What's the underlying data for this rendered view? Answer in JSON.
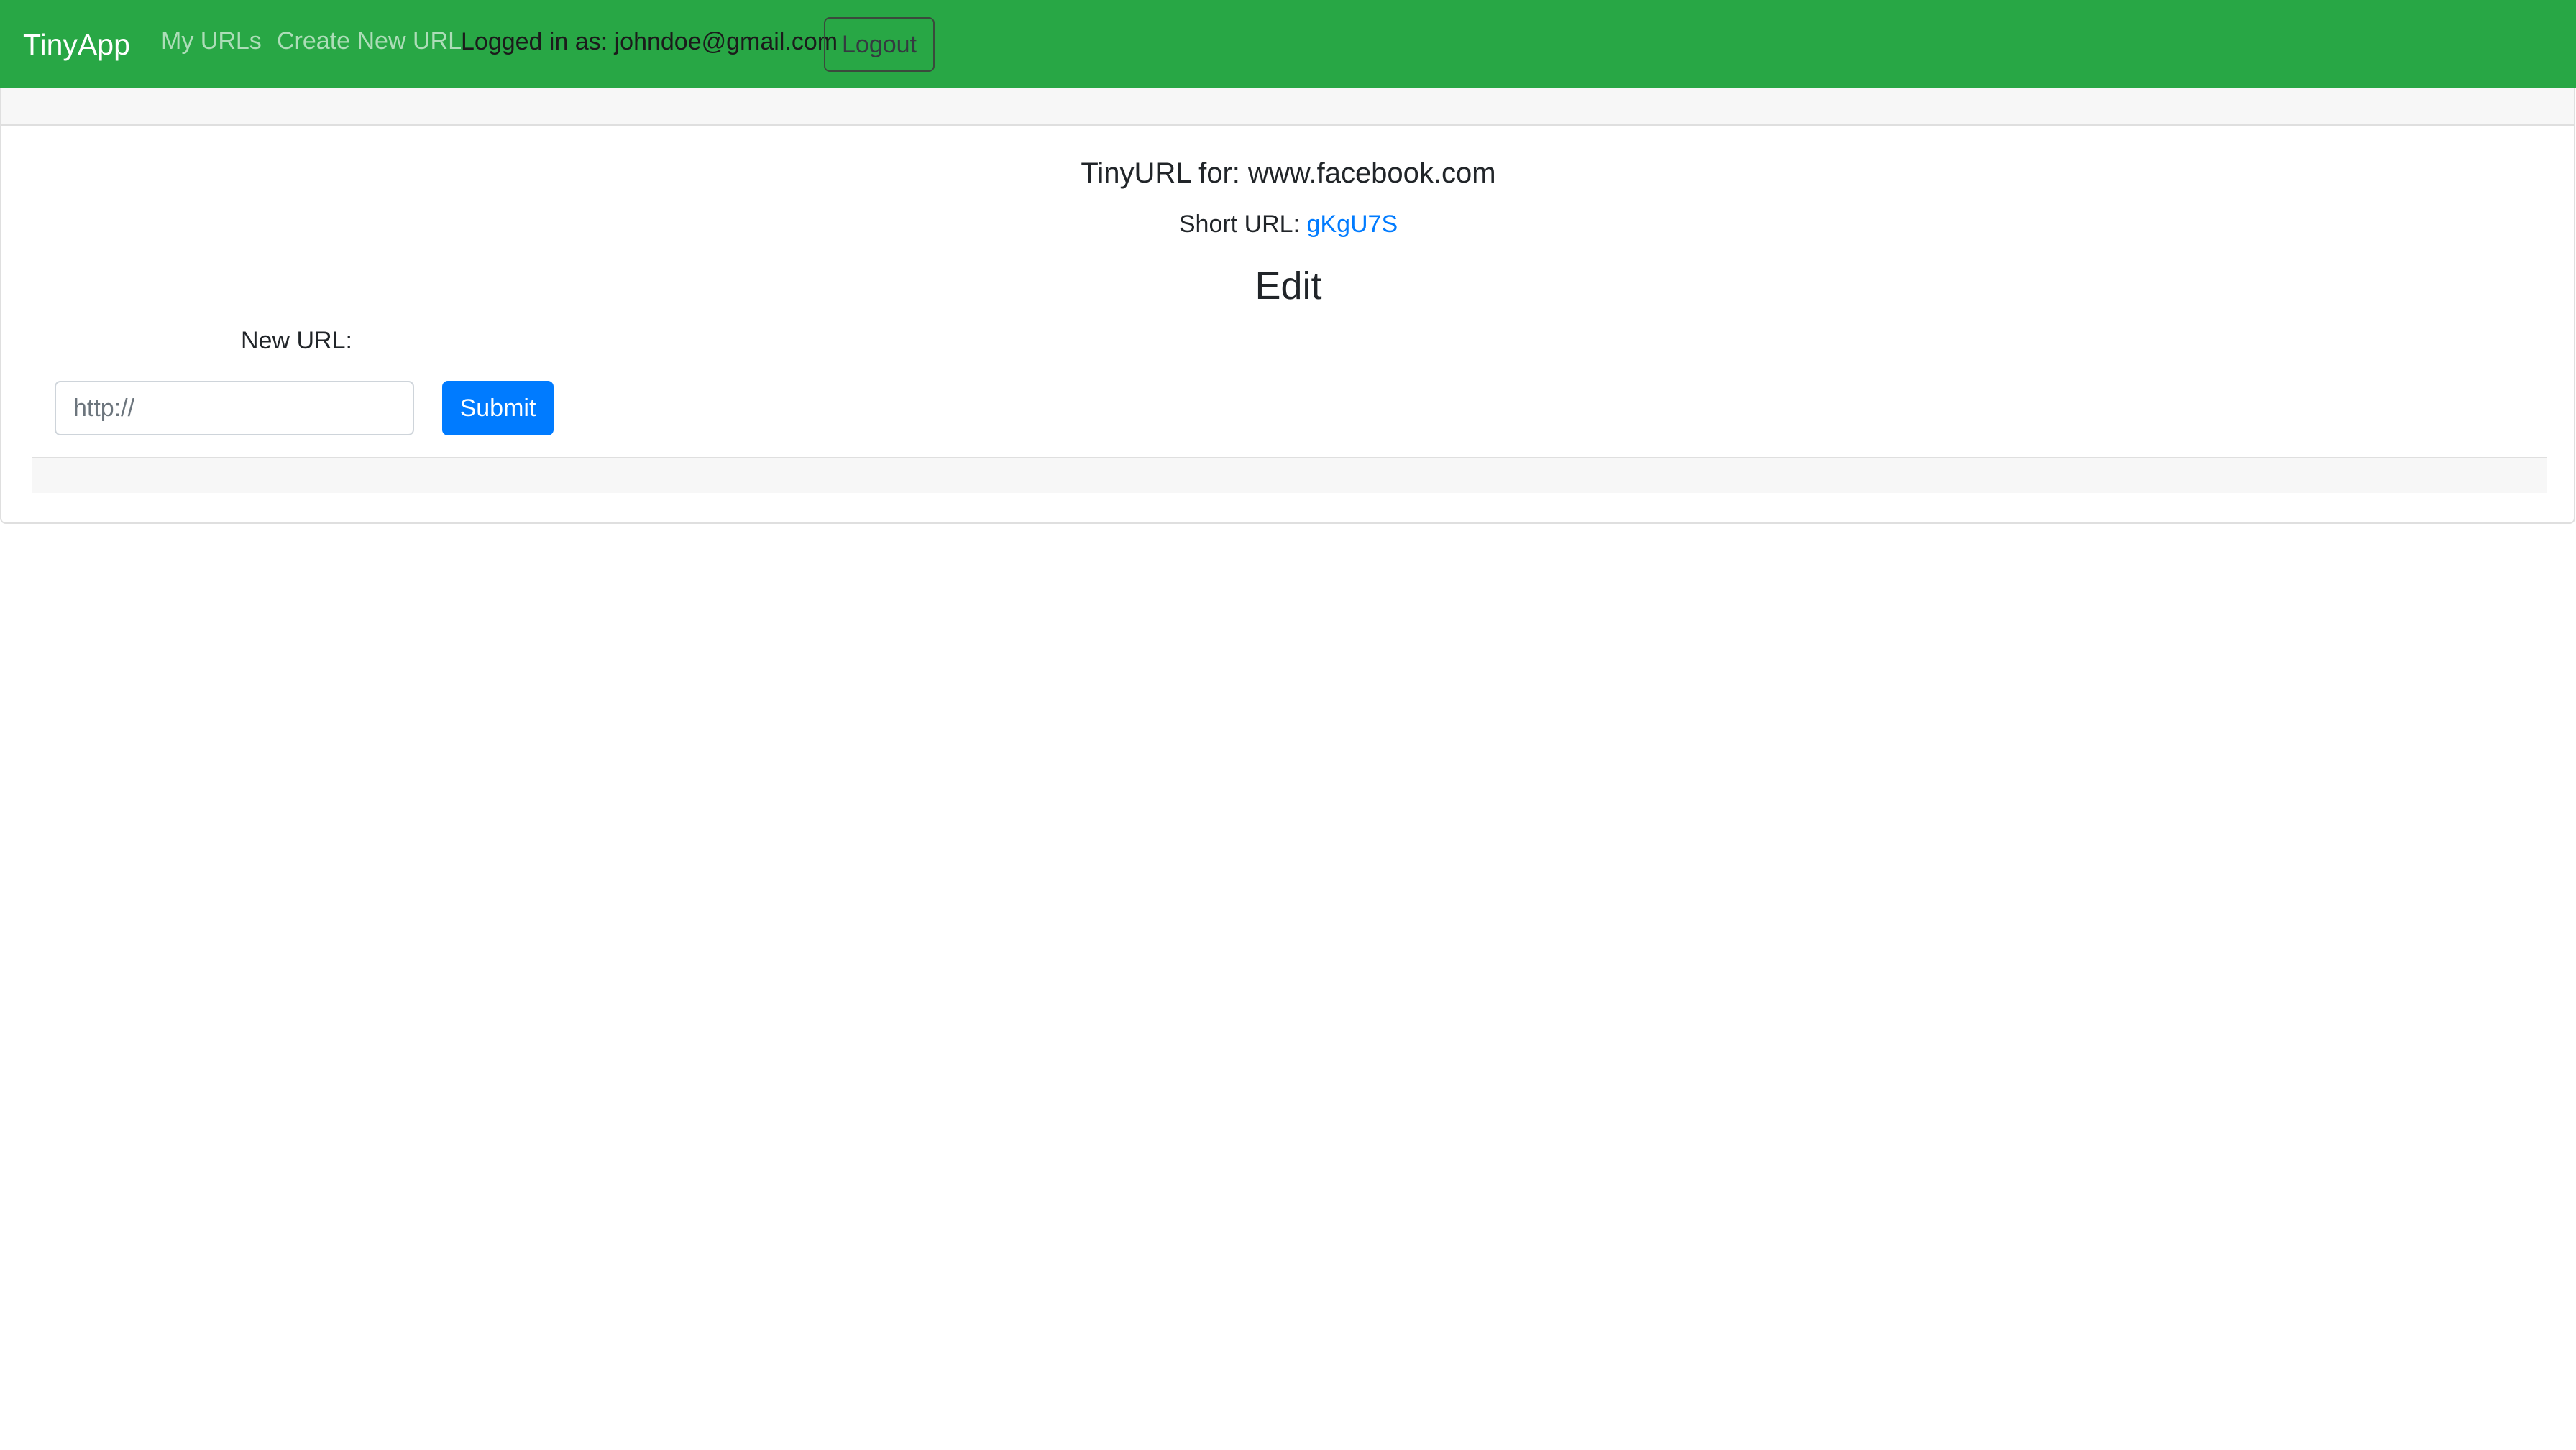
{
  "colors": {
    "brand": "#28a745",
    "primary": "#007bff",
    "link": "#007bff"
  },
  "navbar": {
    "brand": "TinyApp",
    "links": [
      {
        "label": "My URLs"
      },
      {
        "label": "Create New URL"
      }
    ],
    "logged_in_text": "Logged in as: johndoe@gmail.com",
    "logout_label": "Logout"
  },
  "card": {
    "title": "TinyURL for: www.facebook.com",
    "short_url_label": "Short URL:",
    "short_url_value": "gKgU7S",
    "edit_heading": "Edit",
    "form": {
      "label": "New URL:",
      "placeholder": "http://",
      "value": "",
      "submit_label": "Submit"
    }
  }
}
